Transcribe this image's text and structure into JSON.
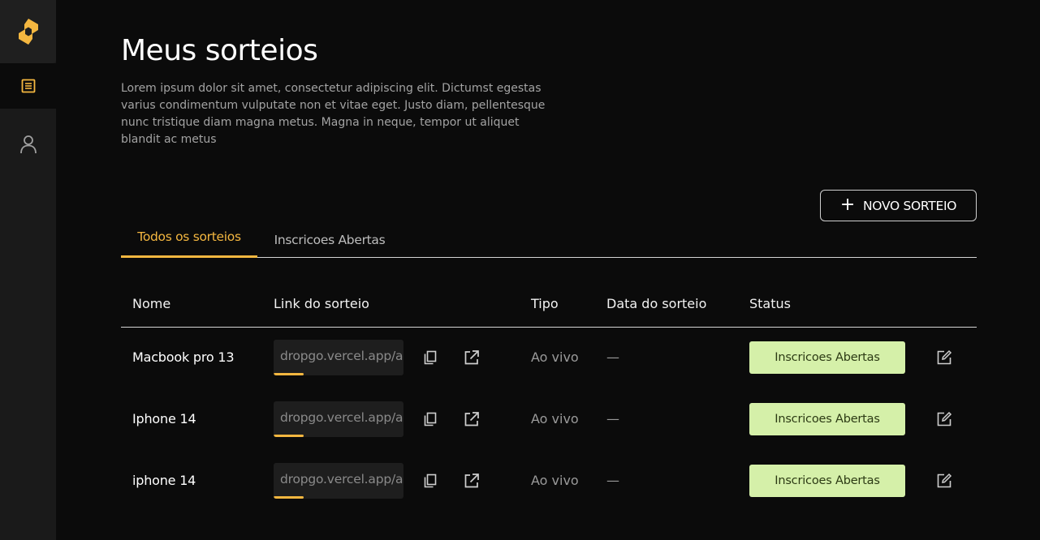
{
  "page": {
    "title": "Meus sorteios",
    "description": "Lorem ipsum dolor sit amet, consectetur adipiscing elit. Dictumst egestas varius condimentum vulputate non et vitae eget. Justo diam, pellentesque nunc tristique diam magna metus. Magna in neque, tempor ut aliquet blandit ac metus"
  },
  "sidebar": {
    "items": [
      {
        "icon": "logo-icon"
      },
      {
        "icon": "document-list-icon",
        "active": true
      },
      {
        "icon": "user-icon"
      }
    ]
  },
  "toolbar": {
    "new_button_label": "NOVO SORTEIO"
  },
  "tabs": [
    {
      "label": "Todos os sorteios",
      "active": true
    },
    {
      "label": "Inscricoes Abertas",
      "active": false
    }
  ],
  "table": {
    "headers": [
      "Nome",
      "Link do sorteio",
      "Tipo",
      "Data do sorteio",
      "Status"
    ],
    "rows": [
      {
        "name": "Macbook pro 13",
        "link": "dropgo.vercel.app/a",
        "tipo": "Ao vivo",
        "data": "—",
        "status": "Inscricoes Abertas"
      },
      {
        "name": "Iphone 14",
        "link": "dropgo.vercel.app/a",
        "tipo": "Ao vivo",
        "data": "—",
        "status": "Inscricoes Abertas"
      },
      {
        "name": "iphone 14",
        "link": "dropgo.vercel.app/a",
        "tipo": "Ao vivo",
        "data": "—",
        "status": "Inscricoes Abertas"
      }
    ]
  },
  "colors": {
    "accent": "#f4b740",
    "status_bg": "#d5f0a9",
    "background": "#0b0b0b",
    "sidebar": "#1a1a1a"
  }
}
